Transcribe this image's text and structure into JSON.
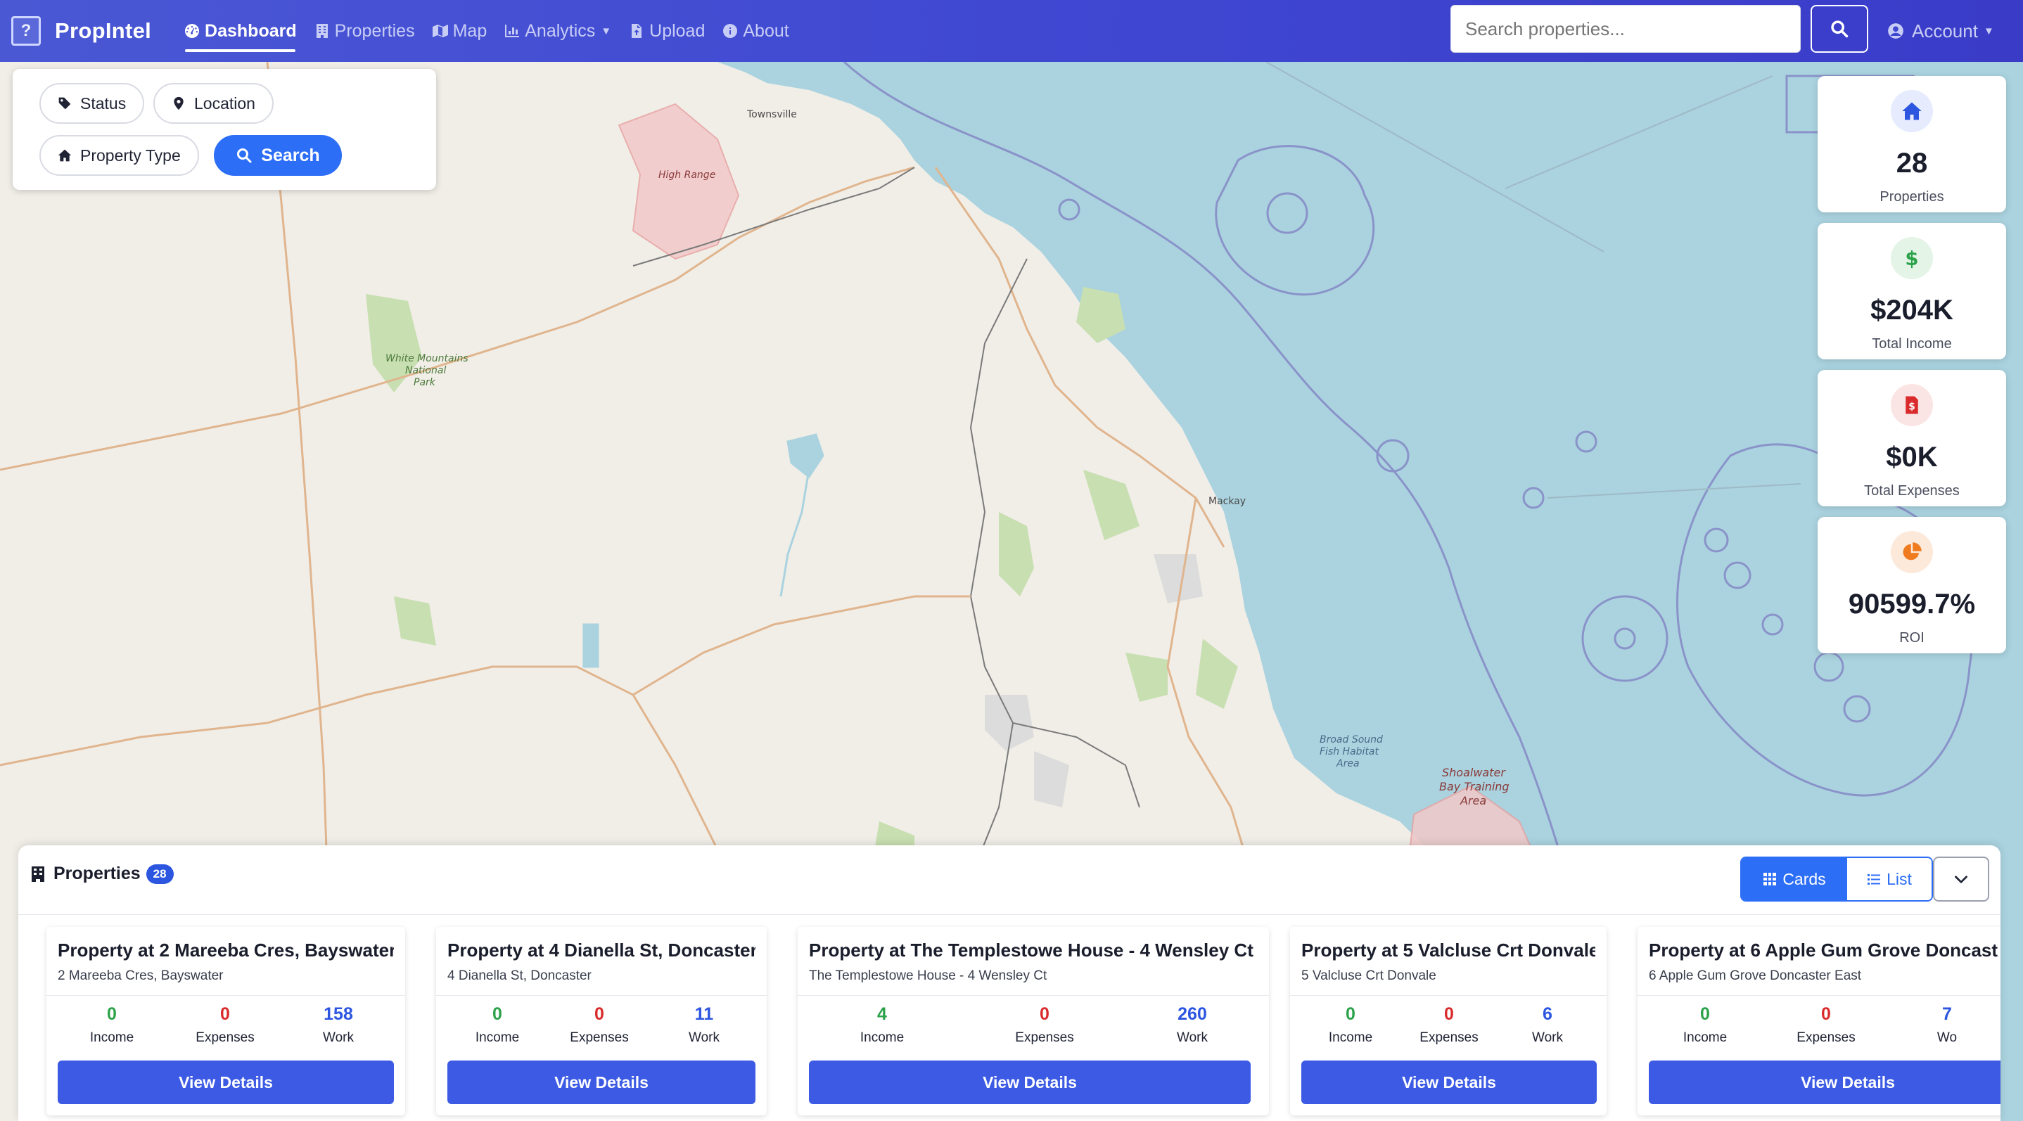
{
  "nav": {
    "brand_logo": "?",
    "brand": "PropIntel",
    "links": [
      {
        "label": "Dashboard",
        "icon": "gauge-icon"
      },
      {
        "label": "Properties",
        "icon": "building-icon"
      },
      {
        "label": "Map",
        "icon": "map-icon"
      },
      {
        "label": "Analytics",
        "icon": "chart-icon"
      },
      {
        "label": "Upload",
        "icon": "file-upload-icon"
      },
      {
        "label": "About",
        "icon": "info-icon"
      }
    ],
    "search_placeholder": "Search properties...",
    "account_label": "Account"
  },
  "filters": {
    "status_label": "Status",
    "location_label": "Location",
    "property_type_label": "Property Type",
    "search_label": "Search"
  },
  "map": {
    "labels": [
      "Townsville",
      "High Range",
      "White Mountains",
      "National",
      "Park",
      "Mackay",
      "Broad Sound",
      "Fish Habitat",
      "Area",
      "Shoalwater",
      "Bay Training",
      "Area"
    ]
  },
  "stats": [
    {
      "value": "28",
      "label": "Properties",
      "icon": "home-icon",
      "color": "#2d56e0"
    },
    {
      "value": "$204K",
      "label": "Total Income",
      "icon": "dollar-icon",
      "color": "#2ca24a"
    },
    {
      "value": "$0K",
      "label": "Total Expenses",
      "icon": "invoice-icon",
      "color": "#d92b2b"
    },
    {
      "value": "90599.7%",
      "label": "ROI",
      "icon": "pie-chart-icon",
      "color": "#f07a1e"
    }
  ],
  "properties_panel": {
    "title": "Properties",
    "count": "28",
    "cards_label": "Cards",
    "list_label": "List"
  },
  "property_cards": [
    {
      "title": "Property at 2 Mareeba Cres, Bayswater",
      "address": "2 Mareeba Cres, Bayswater",
      "income": "0",
      "expenses": "0",
      "work": "158",
      "income_label": "Income",
      "expenses_label": "Expenses",
      "work_label": "Work",
      "button": "View Details"
    },
    {
      "title": "Property at 4 Dianella St, Doncaster",
      "address": "4 Dianella St, Doncaster",
      "income": "0",
      "expenses": "0",
      "work": "11",
      "income_label": "Income",
      "expenses_label": "Expenses",
      "work_label": "Work",
      "button": "View Details"
    },
    {
      "title": "Property at The Templestowe House - 4 Wensley Ct",
      "address": "The Templestowe House - 4 Wensley Ct",
      "income": "4",
      "expenses": "0",
      "work": "260",
      "income_label": "Income",
      "expenses_label": "Expenses",
      "work_label": "Work",
      "button": "View Details"
    },
    {
      "title": "Property at 5 Valcluse Crt Donvale",
      "address": "5 Valcluse Crt Donvale",
      "income": "0",
      "expenses": "0",
      "work": "6",
      "income_label": "Income",
      "expenses_label": "Expenses",
      "work_label": "Work",
      "button": "View Details"
    },
    {
      "title": "Property at 6 Apple Gum Grove Doncast",
      "address": "6 Apple Gum Grove Doncaster East",
      "income": "0",
      "expenses": "0",
      "work": "7",
      "income_label": "Income",
      "expenses_label": "Expenses",
      "work_label": "Wo",
      "button": "View Details"
    }
  ]
}
